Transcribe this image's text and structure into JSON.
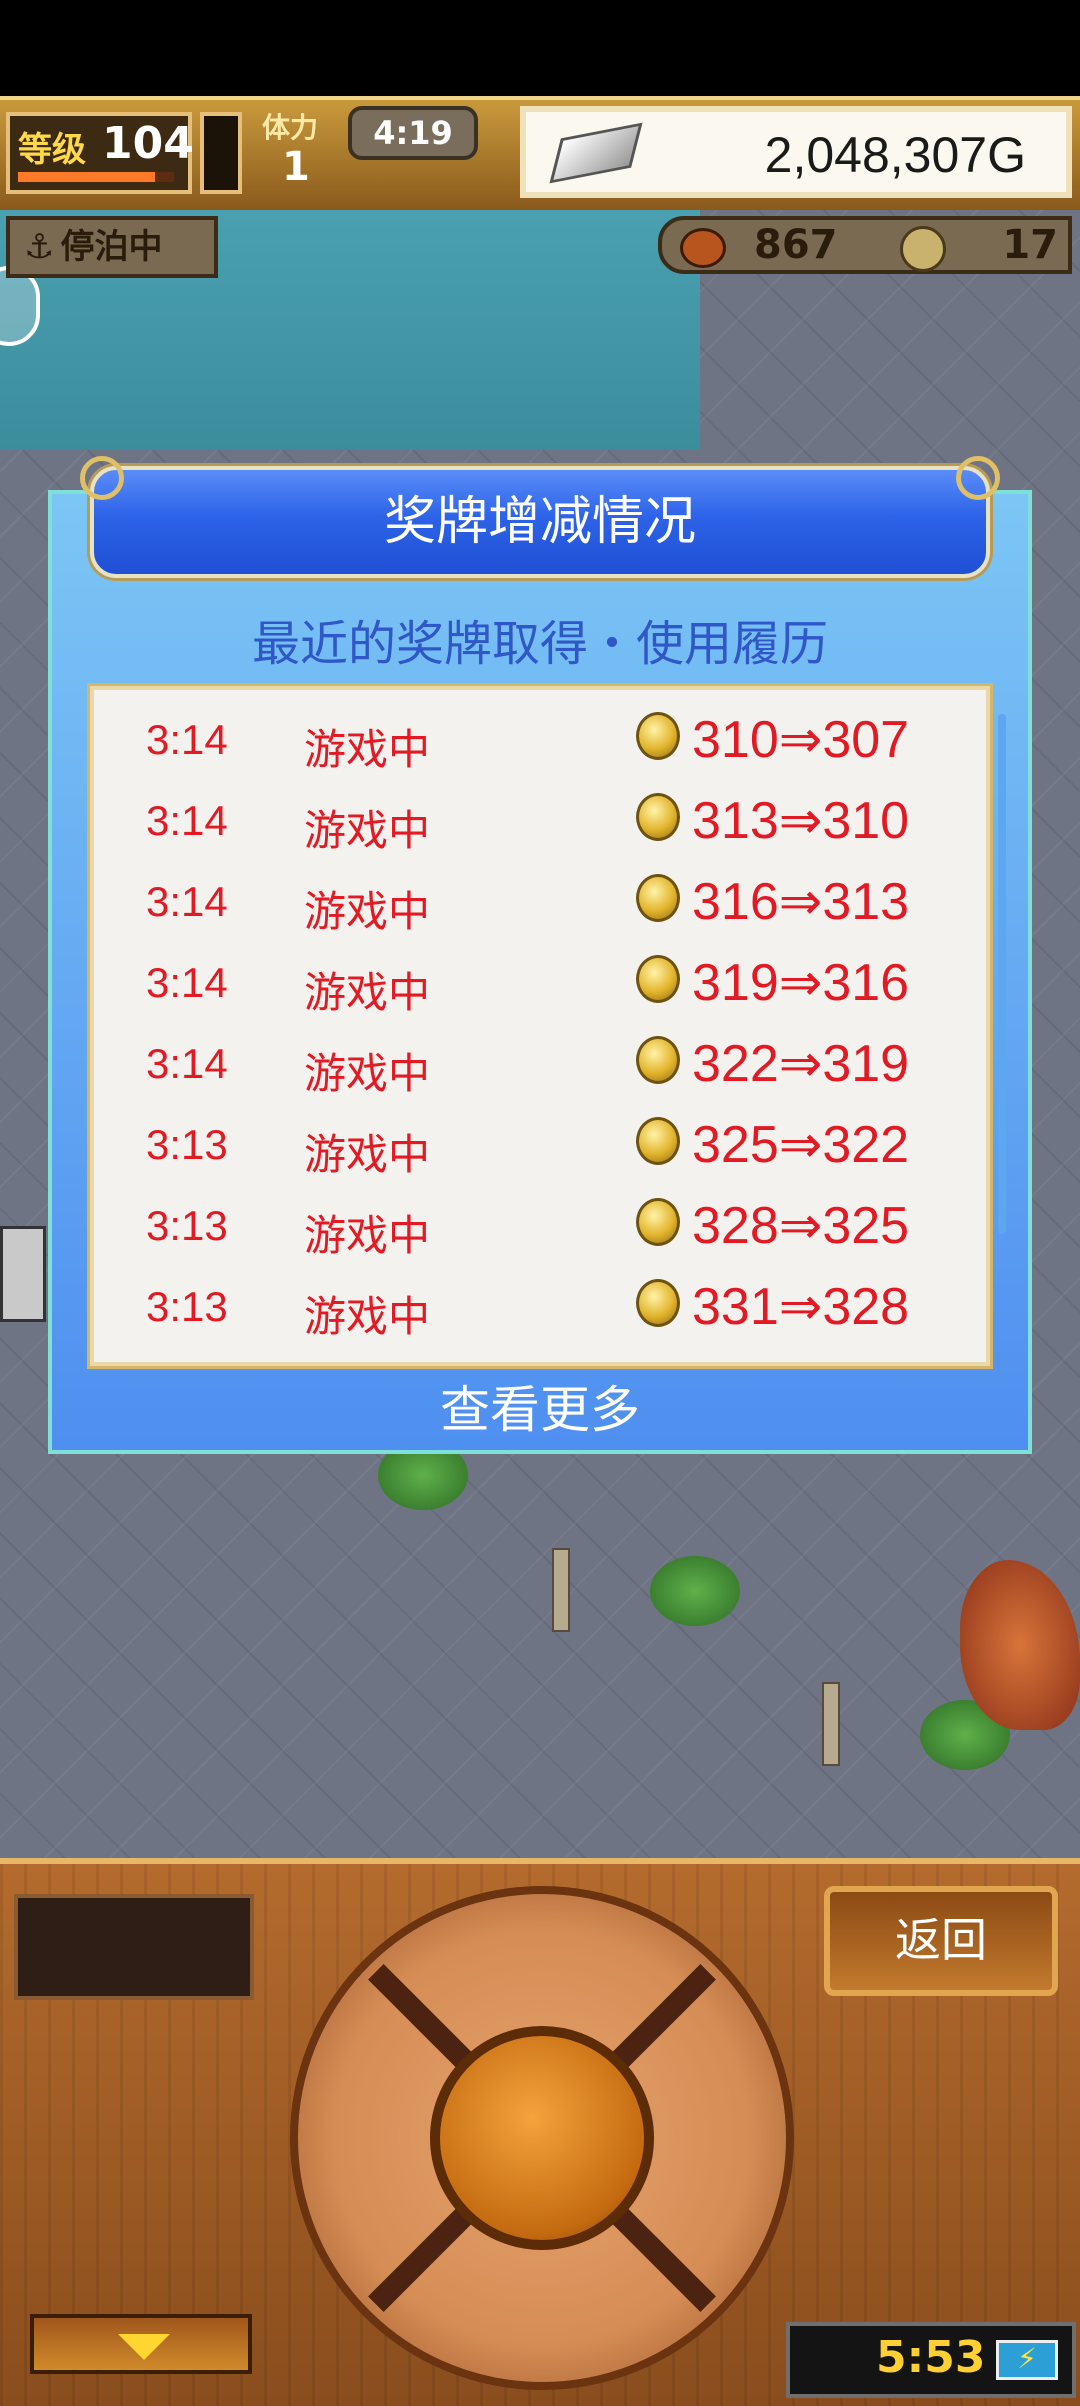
{
  "hud": {
    "level_label": "等级",
    "level": "104",
    "stamina_label": "体力",
    "stamina": "1",
    "timer": "4:19",
    "money": "2,048,307G",
    "docked_label": "停泊中",
    "food": "867",
    "medals": "17"
  },
  "dialog": {
    "title": "奖牌增减情况",
    "subtitle": "最近的奖牌取得・使用履历",
    "rows": [
      {
        "time": "3:14",
        "status": "游戏中",
        "change": "310⇒307"
      },
      {
        "time": "3:14",
        "status": "游戏中",
        "change": "313⇒310"
      },
      {
        "time": "3:14",
        "status": "游戏中",
        "change": "316⇒313"
      },
      {
        "time": "3:14",
        "status": "游戏中",
        "change": "319⇒316"
      },
      {
        "time": "3:14",
        "status": "游戏中",
        "change": "322⇒319"
      },
      {
        "time": "3:13",
        "status": "游戏中",
        "change": "325⇒322"
      },
      {
        "time": "3:13",
        "status": "游戏中",
        "change": "328⇒325"
      },
      {
        "time": "3:13",
        "status": "游戏中",
        "change": "331⇒328"
      }
    ],
    "see_more": "查看更多"
  },
  "controls": {
    "back_label": "返回",
    "clock": "5:53"
  },
  "icons": {
    "anchor": "anchor-icon",
    "coin": "medal-coin-icon",
    "battery": "battery-charging-icon"
  },
  "colors": {
    "list_text": "#e21a24",
    "dialog_bg": "#4e8ff0",
    "header_bg": "#2d63e8"
  }
}
